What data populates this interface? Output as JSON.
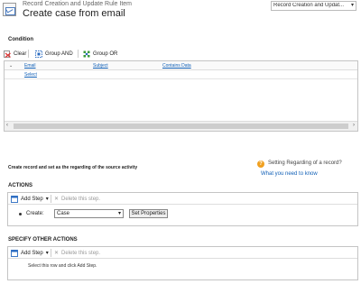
{
  "header": {
    "entity_title": "Record Creation and Update Rule Item",
    "page_title": "Create case from email",
    "record_selector": "Record Creation and Updat..."
  },
  "condition": {
    "label": "Condition",
    "toolbar": {
      "clear": "Clear",
      "group_and": "Group AND",
      "group_or": "Group OR"
    },
    "columns": [
      "Email",
      "Subject",
      "Contains Data"
    ],
    "rows": [
      {
        "field": "Select"
      }
    ]
  },
  "source_activity": {
    "text": "Create record and set as the regarding of the source activity",
    "help_question": "Setting Regarding of a record?",
    "help_link": "What you need to know"
  },
  "actions": {
    "label": "ACTIONS",
    "add_step": "Add Step",
    "delete_step": "Delete this step.",
    "step": {
      "label": "Create:",
      "entity": "Case",
      "set_properties": "Set Properties"
    }
  },
  "other_actions": {
    "label": "SPECIFY OTHER ACTIONS",
    "add_step": "Add Step",
    "delete_step": "Delete this step.",
    "hint": "Select this row and click Add Step."
  },
  "colors": {
    "link": "#1160b7",
    "help_icon": "#f0a020"
  }
}
